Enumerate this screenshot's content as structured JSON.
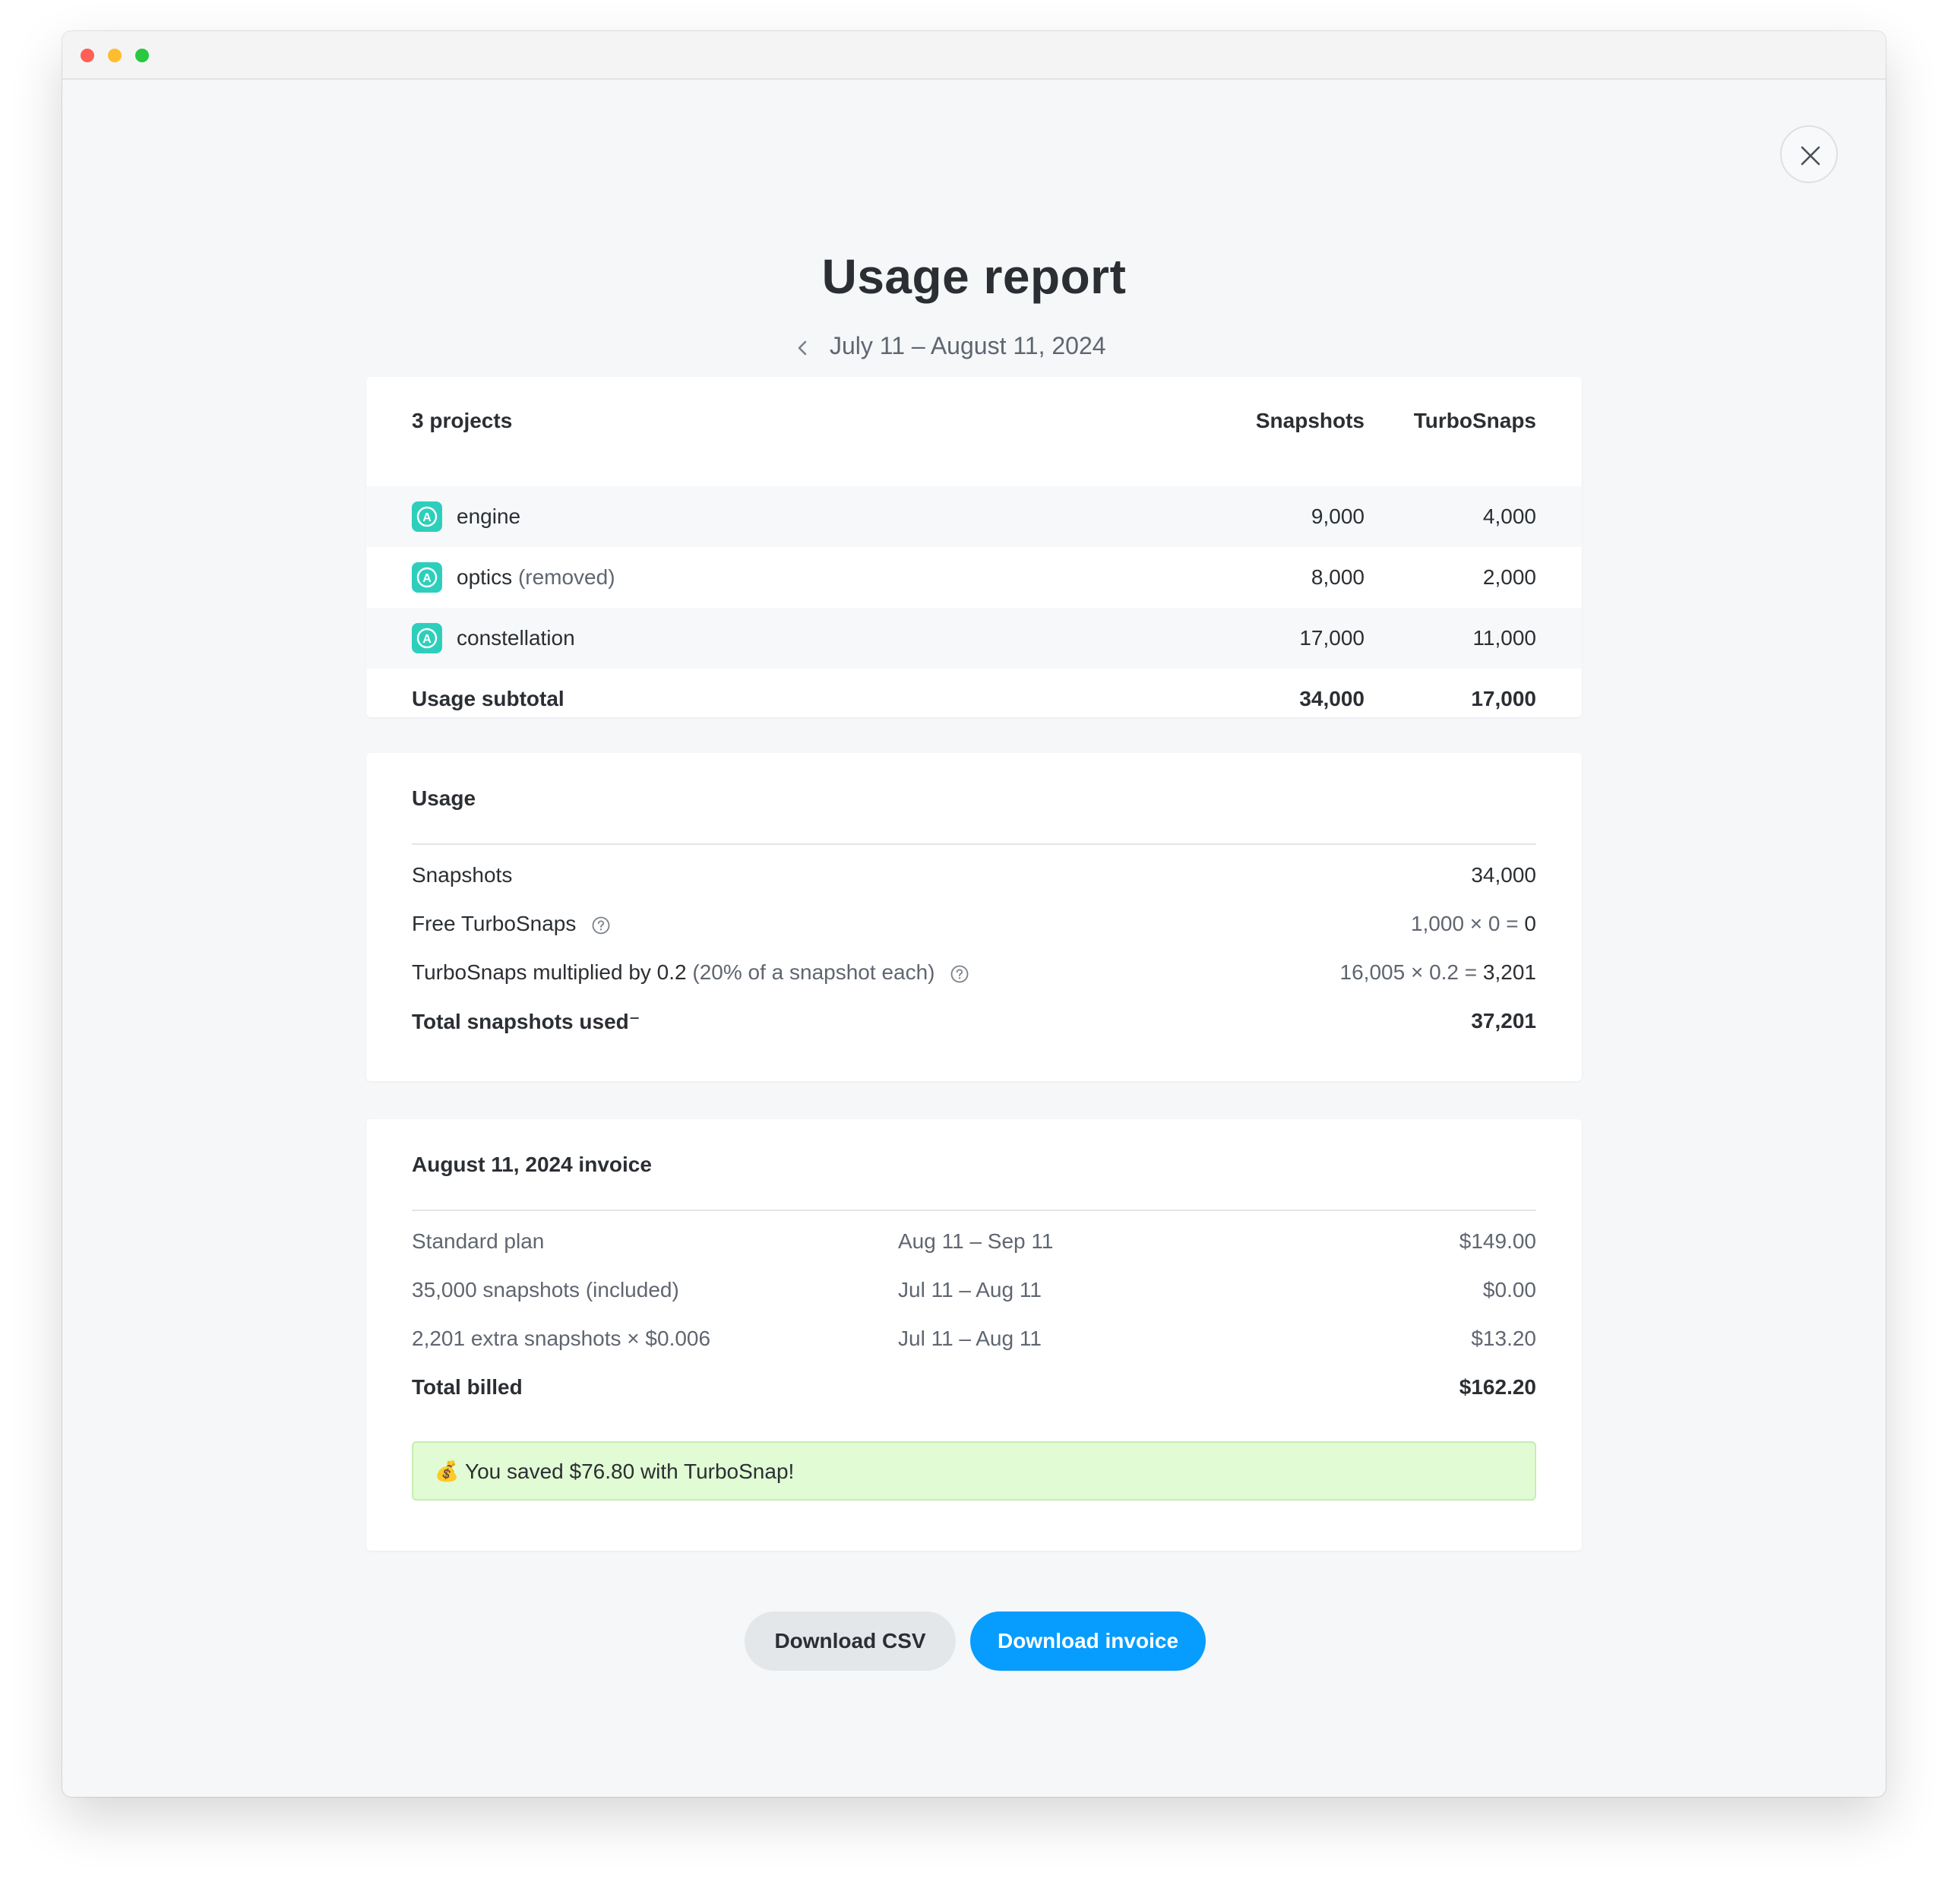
{
  "header": {
    "title": "Usage report",
    "period": "July 11 – August 11, 2024"
  },
  "projects_table": {
    "heading": "3 projects",
    "columns": [
      "Snapshots",
      "TurboSnaps"
    ],
    "rows": [
      {
        "name": "engine",
        "note": "",
        "snapshots": "9,000",
        "turbosnaps": "4,000"
      },
      {
        "name": "optics",
        "note": "(removed)",
        "snapshots": "8,000",
        "turbosnaps": "2,000"
      },
      {
        "name": "constellation",
        "note": "",
        "snapshots": "17,000",
        "turbosnaps": "11,000"
      }
    ],
    "subtotal": {
      "label": "Usage subtotal",
      "snapshots": "34,000",
      "turbosnaps": "17,000"
    }
  },
  "usage": {
    "heading": "Usage",
    "snapshots": {
      "label": "Snapshots",
      "value": "34,000"
    },
    "free_turbosnaps": {
      "label": "Free TurboSnaps",
      "calc": "1,000 × 0 =",
      "result": "0"
    },
    "turbosnaps_mult": {
      "label": "TurboSnaps multiplied by 0.2",
      "note": "(20% of a snapshot each)",
      "calc": "16,005 × 0.2 =",
      "result": "3,201"
    },
    "total": {
      "label": "Total snapshots used",
      "mark": "⁻",
      "value": "37,201"
    }
  },
  "invoice": {
    "heading": "August 11, 2024 invoice",
    "lines": [
      {
        "item": "Standard plan",
        "period": "Aug 11 – Sep 11",
        "amount": "$149.00"
      },
      {
        "item": "35,000 snapshots (included)",
        "period": "Jul 11 – Aug 11",
        "amount": "$0.00"
      },
      {
        "item": "2,201 extra snapshots × $0.006",
        "period": "Jul 11 – Aug 11",
        "amount": "$13.20"
      }
    ],
    "total": {
      "label": "Total billed",
      "amount": "$162.20"
    },
    "savings": {
      "emoji": "💰",
      "text": "You saved $76.80 with TurboSnap!"
    }
  },
  "actions": {
    "download_csv": "Download CSV",
    "download_invoice": "Download invoice"
  },
  "colors": {
    "accent": "#079dff",
    "project_icon": "#2dcfbc",
    "savings_bg": "#e1fbd4"
  },
  "icons": {
    "close": "close-icon",
    "prev": "chevron-left-icon",
    "project": "chromatic-app-icon",
    "help": "help-circle-icon"
  }
}
